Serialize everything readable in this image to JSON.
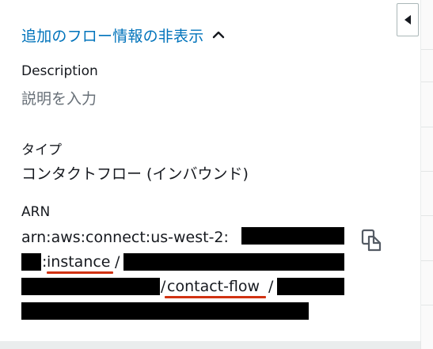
{
  "section": {
    "toggle_label": "追加のフロー情報の非表示"
  },
  "description": {
    "label": "Description",
    "placeholder": "説明を入力",
    "value": ""
  },
  "type": {
    "label": "タイプ",
    "value": "コンタクトフロー (インバウンド)"
  },
  "arn": {
    "label": "ARN",
    "line1_prefix": "arn:aws:connect:us-west-2:",
    "line2_colon": ":",
    "line2_instance": "instance",
    "line2_slash": "/",
    "line3_slash_before": "/",
    "line3_contact_flow": "contact-flow",
    "line3_slash_after": "/"
  },
  "icons": {
    "collapse": "caret-left-icon",
    "toggle": "chevron-up-icon",
    "copy": "copy-icon"
  },
  "colors": {
    "link": "#0073bb",
    "redaction": "#000000",
    "underline_highlight": "#d13212"
  }
}
